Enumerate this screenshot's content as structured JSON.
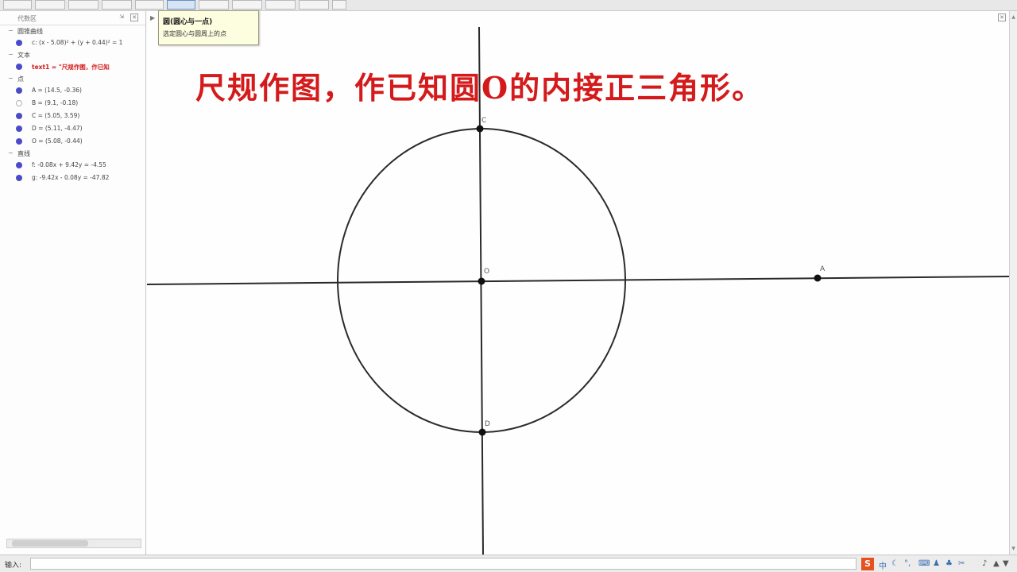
{
  "tooltip": {
    "title": "圆(圆心与一点)",
    "description": "选定圆心与圆周上的点"
  },
  "algebra": {
    "header_title": "代数区",
    "categories": [
      {
        "label": "圆锥曲线",
        "items": [
          {
            "text": "c: (x - 5.08)² + (y + 0.44)² = 1",
            "style": "normal",
            "dot": "filled"
          }
        ]
      },
      {
        "label": "文本",
        "items": [
          {
            "text": "text1 = \"尺规作图，作已知",
            "style": "red",
            "dot": "filled"
          }
        ]
      },
      {
        "label": "点",
        "items": [
          {
            "text": "A = (14.5, -0.36)",
            "style": "normal",
            "dot": "filled"
          },
          {
            "text": "B = (9.1, -0.18)",
            "style": "normal",
            "dot": "hollow"
          },
          {
            "text": "C = (5.05, 3.59)",
            "style": "normal",
            "dot": "filled"
          },
          {
            "text": "D = (5.11, -4.47)",
            "style": "normal",
            "dot": "filled"
          },
          {
            "text": "O = (5.08, -0.44)",
            "style": "normal",
            "dot": "filled"
          }
        ]
      },
      {
        "label": "直线",
        "items": [
          {
            "text": "f: -0.08x + 9.42y = -4.55",
            "style": "normal",
            "dot": "filled"
          },
          {
            "text": "g: -9.42x - 0.08y = -47.82",
            "style": "normal",
            "dot": "filled"
          }
        ]
      }
    ]
  },
  "graphics": {
    "title": "尺规作图，作已知圆O的内接正三角形。",
    "points": [
      {
        "name": "O",
        "label": "O"
      },
      {
        "name": "A",
        "label": "A"
      },
      {
        "name": "C",
        "label": "C"
      },
      {
        "name": "D",
        "label": "D"
      }
    ]
  },
  "inputbar": {
    "label": "输入:",
    "value": ""
  },
  "colors": {
    "title_red": "#d41a1a",
    "dot_blue": "#4b4bc8",
    "tooltip_bg": "#fdfde0"
  }
}
